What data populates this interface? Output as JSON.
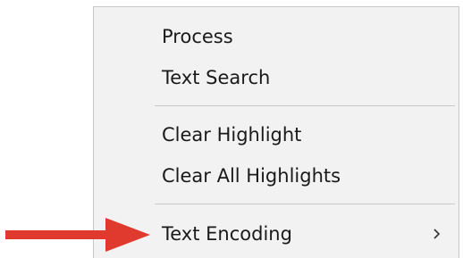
{
  "menu": {
    "items": [
      {
        "id": "process",
        "label": "Process"
      },
      {
        "id": "text-search",
        "label": "Text Search"
      },
      {
        "id": "clear-highlight",
        "label": "Clear Highlight"
      },
      {
        "id": "clear-all-highlights",
        "label": "Clear All Highlights"
      },
      {
        "id": "text-encoding",
        "label": "Text Encoding",
        "has_submenu": true
      }
    ]
  },
  "annotation": {
    "arrow_color": "#e03a2f",
    "points_to": "text-encoding"
  },
  "colors": {
    "menu_background": "#f2f2f2",
    "separator": "#c9c9c9",
    "text": "#1a1a1a"
  }
}
